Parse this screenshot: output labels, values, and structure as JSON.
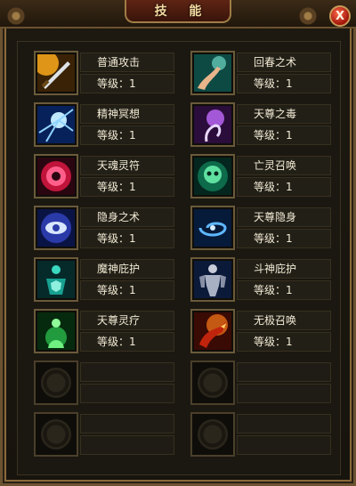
{
  "window": {
    "title": "技 能",
    "close_label": "X"
  },
  "level_label": "等级：",
  "skills": [
    {
      "name": "普通攻击",
      "level": "1",
      "icon": "sword-slash-icon"
    },
    {
      "name": "回春之术",
      "level": "1",
      "icon": "healing-hand-icon"
    },
    {
      "name": "精神冥想",
      "level": "1",
      "icon": "light-burst-icon"
    },
    {
      "name": "天尊之毒",
      "level": "1",
      "icon": "poison-hand-icon"
    },
    {
      "name": "天魂灵符",
      "level": "1",
      "icon": "red-talisman-icon"
    },
    {
      "name": "亡灵召唤",
      "level": "1",
      "icon": "skull-summon-icon"
    },
    {
      "name": "隐身之术",
      "level": "1",
      "icon": "eye-rune-icon"
    },
    {
      "name": "天尊隐身",
      "level": "1",
      "icon": "vortex-icon"
    },
    {
      "name": "魔神庇护",
      "level": "1",
      "icon": "shield-warrior-icon"
    },
    {
      "name": "斗神庇护",
      "level": "1",
      "icon": "armored-warrior-icon"
    },
    {
      "name": "天尊灵疗",
      "level": "1",
      "icon": "green-heal-icon"
    },
    {
      "name": "无极召唤",
      "level": "1",
      "icon": "dragon-summon-icon"
    }
  ],
  "empty_slots": 4,
  "colors": {
    "accent": "#a07c46",
    "text": "#f1ead4",
    "close": "#c0201a"
  }
}
